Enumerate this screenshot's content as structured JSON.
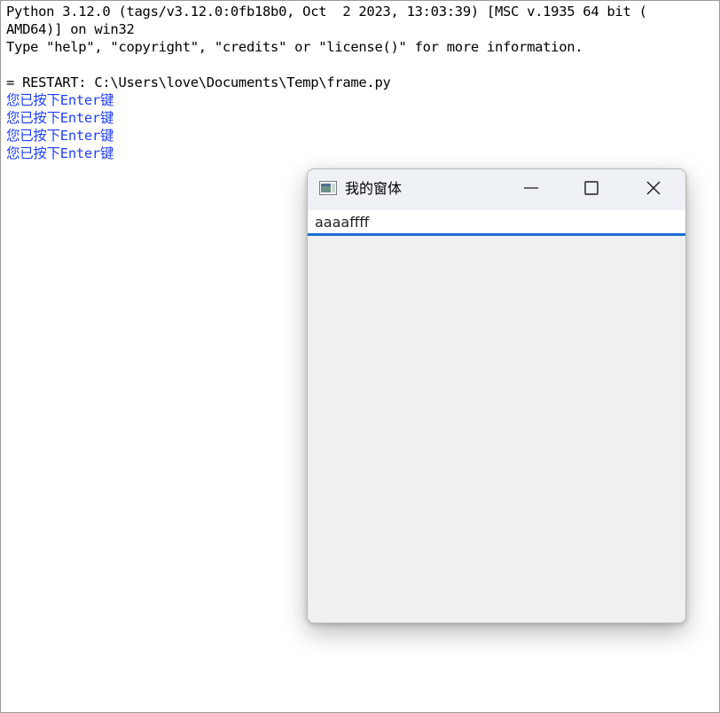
{
  "shell": {
    "lines": [
      {
        "text": "Python 3.12.0 (tags/v3.12.0:0fb18b0, Oct  2 2023, 13:03:39) [MSC v.1935 64 bit (",
        "kind": "banner"
      },
      {
        "text": "AMD64)] on win32",
        "kind": "banner"
      },
      {
        "text": "Type \"help\", \"copyright\", \"credits\" or \"license()\" for more information.",
        "kind": "banner"
      },
      {
        "text": "",
        "kind": "blank"
      },
      {
        "text": "= RESTART: C:\\Users\\love\\Documents\\Temp\\frame.py",
        "kind": "restart"
      },
      {
        "text": "您已按下Enter键",
        "kind": "out"
      },
      {
        "text": "您已按下Enter键",
        "kind": "out"
      },
      {
        "text": "您已按下Enter键",
        "kind": "out"
      },
      {
        "text": "您已按下Enter键",
        "kind": "out"
      }
    ]
  },
  "window": {
    "title": "我的窗体",
    "entry_value": "aaaaffff",
    "icons": {
      "app": "tk-app-icon",
      "minimize": "minimize-icon",
      "maximize": "maximize-icon",
      "close": "close-icon"
    }
  },
  "colors": {
    "shell_output": "#1f3fff",
    "entry_focus_border": "#1a6fd0"
  }
}
